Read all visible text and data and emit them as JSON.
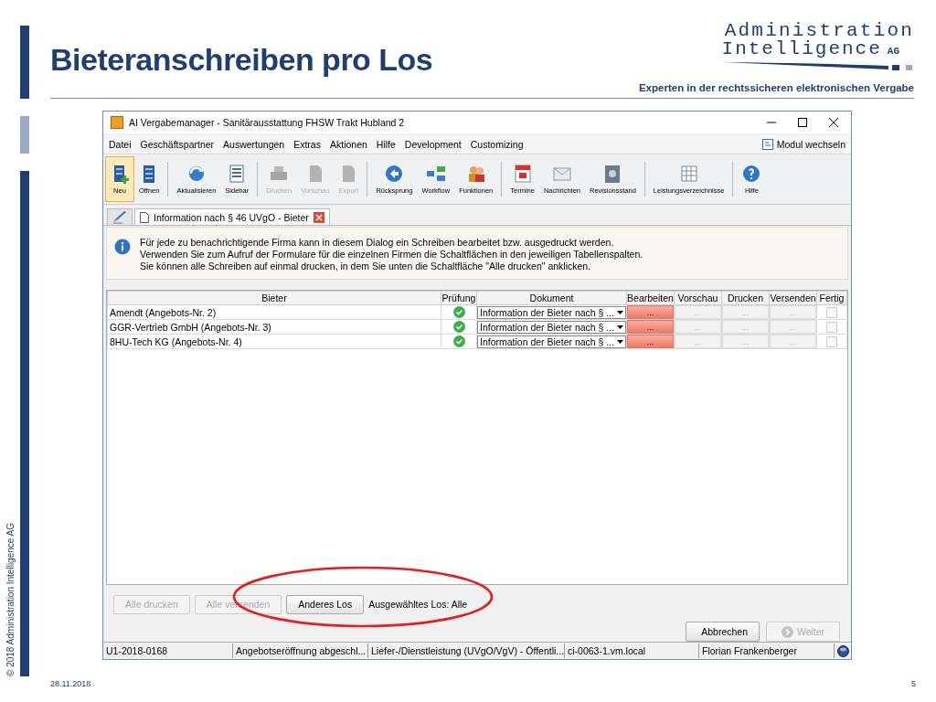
{
  "slide": {
    "title": "Bieteranschreiben pro Los",
    "logo_line1": "Administration",
    "logo_line2": "Intelligence",
    "logo_suffix": "AG",
    "tagline": "Experten in der rechtssicheren elektronischen Vergabe",
    "copyright": "© 2018 Administration Intelligence AG",
    "date": "28.11.2018",
    "page": "5"
  },
  "window": {
    "title": "AI Vergabemanager - Sanitärausstattung FHSW Trakt Hubland 2",
    "menu": [
      "Datei",
      "Geschäftspartner",
      "Auswertungen",
      "Extras",
      "Aktionen",
      "Hilfe",
      "Development",
      "Customizing"
    ],
    "module_switch": "Modul wechseln",
    "toolbar": [
      {
        "items": [
          {
            "label": "Neu",
            "selected": true,
            "disabled": false
          },
          {
            "label": "Offnen",
            "selected": false,
            "disabled": false
          }
        ]
      },
      {
        "items": [
          {
            "label": "Aktualisieren",
            "selected": false,
            "disabled": false
          },
          {
            "label": "Sidebar",
            "selected": false,
            "disabled": false
          }
        ]
      },
      {
        "items": [
          {
            "label": "Drucken",
            "selected": false,
            "disabled": true
          },
          {
            "label": "Vorschau",
            "selected": false,
            "disabled": true
          },
          {
            "label": "Export",
            "selected": false,
            "disabled": true
          }
        ]
      },
      {
        "items": [
          {
            "label": "Rücksprung",
            "selected": false,
            "disabled": false
          },
          {
            "label": "Workflow",
            "selected": false,
            "disabled": false
          },
          {
            "label": "Funktionen",
            "selected": false,
            "disabled": false
          }
        ]
      },
      {
        "items": [
          {
            "label": "Termine",
            "selected": false,
            "disabled": false
          },
          {
            "label": "Nachrichten",
            "selected": false,
            "disabled": false
          },
          {
            "label": "Revisionsstand",
            "selected": false,
            "disabled": false
          }
        ]
      },
      {
        "items": [
          {
            "label": "Leistungsverzeichnisse",
            "selected": false,
            "disabled": false
          }
        ]
      },
      {
        "items": [
          {
            "label": "Hilfe",
            "selected": false,
            "disabled": false
          }
        ]
      }
    ],
    "tabs": [
      {
        "kind": "icon",
        "selected": false
      },
      {
        "kind": "document",
        "label": "Information nach § 46 UVgO - Bieter",
        "selected": true
      }
    ],
    "info": [
      "Für jede zu benachrichtigende Firma kann in diesem Dialog ein Schreiben bearbeitet bzw. ausgedruckt werden.",
      "Verwenden Sie zum Aufruf der Formulare für die einzelnen Firmen die Schaltflächen in den jeweiligen Tabellenspalten.",
      "Sie können alle Schreiben auf einmal drucken, in dem Sie unten die Schaltfläche \"Alle drucken\" anklicken."
    ],
    "table": {
      "columns": [
        "Bieter",
        "Prüfung",
        "Dokument",
        "Bearbeiten",
        "Vorschau",
        "Drucken",
        "Versenden",
        "Fertig"
      ],
      "rows": [
        {
          "bieter": "Amendt (Angebots-Nr. 2)",
          "check_passed": true,
          "dokument": "Information der Bieter nach § ...",
          "actions": [
            {
              "label": "...",
              "disabled": false
            },
            {
              "label": "...",
              "disabled": true
            },
            {
              "label": "...",
              "disabled": true
            },
            {
              "label": "...",
              "disabled": true
            }
          ],
          "fertig": {
            "checked": false,
            "disabled": true
          }
        },
        {
          "bieter": "GGR-Vertrieb GmbH (Angebots-Nr. 3)",
          "check_passed": true,
          "dokument": "Information der Bieter nach § ...",
          "actions": [
            {
              "label": "...",
              "disabled": false
            },
            {
              "label": "...",
              "disabled": true
            },
            {
              "label": "...",
              "disabled": true
            },
            {
              "label": "...",
              "disabled": true
            }
          ],
          "fertig": {
            "checked": false,
            "disabled": true
          }
        },
        {
          "bieter": "8HU-Tech KG (Angebots-Nr. 4)",
          "check_passed": true,
          "dokument": "Information der Bieter nach § ...",
          "actions": [
            {
              "label": "...",
              "disabled": false
            },
            {
              "label": "...",
              "disabled": true
            },
            {
              "label": "...",
              "disabled": true
            },
            {
              "label": "...",
              "disabled": true
            }
          ],
          "fertig": {
            "checked": false,
            "disabled": true
          }
        }
      ]
    },
    "lower_buttons": [
      {
        "label": "Alle drucken",
        "disabled": true
      },
      {
        "label": "Alle versenden",
        "disabled": true
      },
      {
        "label": "Anderes Los",
        "disabled": false
      }
    ],
    "selected_lot": "Ausgewähltes Los: Alle",
    "dialog_buttons": [
      {
        "kind": "cancel",
        "label": "Abbrechen",
        "disabled": false
      },
      {
        "kind": "next",
        "label": "Weiter",
        "disabled": true
      }
    ],
    "status_bar": [
      "U1-2018-0168",
      "Angebotseröffnung abgeschl...",
      "Liefer-/Dienstleistung (UVgO/VgV) - Öffentli...",
      "ci-0063-1.vm.local",
      "Florian Frankenberger"
    ]
  },
  "annotation": {
    "kind": "ellipse"
  }
}
